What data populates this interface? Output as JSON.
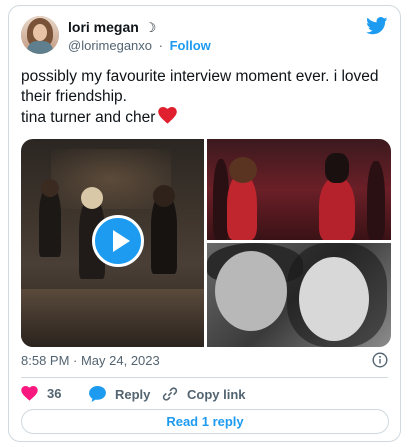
{
  "author": {
    "name": "lori megan",
    "name_emoji": "☽",
    "handle": "@lorimeganxo",
    "separator": "·",
    "follow_label": "Follow"
  },
  "tweet": {
    "line1": "possibly my favourite interview moment ever. i loved",
    "line2": "their friendship.",
    "line3": "tina turner and cher",
    "emoji": "heart"
  },
  "media": {
    "items": [
      "video-thumbnail",
      "photo-stage",
      "photo-bw-portrait"
    ]
  },
  "meta": {
    "timestamp": "8:58 PM · May 24, 2023"
  },
  "actions": {
    "like_count": "36",
    "reply_label": "Reply",
    "copy_link_label": "Copy link",
    "read_replies_label": "Read 1 reply"
  },
  "colors": {
    "accent": "#1d9bf0",
    "like": "#f91880",
    "text": "#0f1419",
    "muted": "#536471",
    "border": "#cfd9de"
  }
}
